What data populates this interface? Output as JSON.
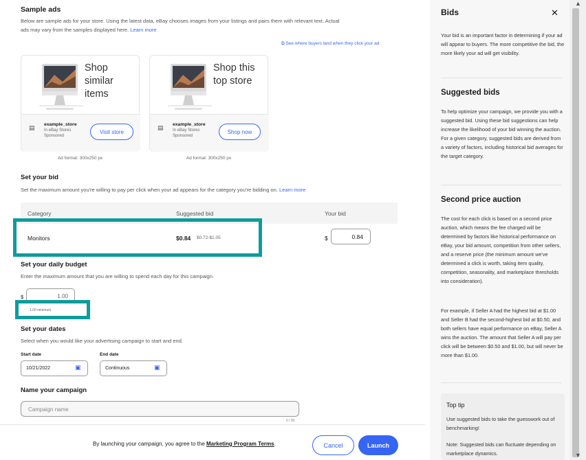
{
  "sample_ads": {
    "title": "Sample ads",
    "desc_line1": "Below are sample ads for your store. Using the latest data, eBay chooses images from your listings and pairs them with relevant text. Actual",
    "desc_line2": "ads may vary from the samples displayed here.",
    "learn_more": "Learn more",
    "buyers_link": "See where buyers land when they click your ad",
    "cards": [
      {
        "headline": "Shop\nsimilar\nitems",
        "store": "example_store",
        "sub1": "In eBay Stores",
        "sub2": "Sponsored",
        "button": "Visit store",
        "format": "Ad format: 300x250 px"
      },
      {
        "headline": "Shop this\ntop store",
        "store": "example_store",
        "sub1": "In eBay Stores",
        "sub2": "Sponsored",
        "button": "Shop now",
        "format": "Ad format: 300x250 px"
      }
    ]
  },
  "bid": {
    "title": "Set your bid",
    "desc": "Set the maximum amount you're willing to pay per click when your ad appears for the category you're bidding on.",
    "learn_more": "Learn more",
    "columns": [
      "Category",
      "Suggested bid",
      "Your bid"
    ],
    "row": {
      "category": "Monitors",
      "suggested": "$0.84",
      "range": "$0.72-$1.05",
      "currency": "$",
      "your_bid": "0.84"
    }
  },
  "budget": {
    "title": "Set your daily budget",
    "desc": "Enter the maximum amount that you are willing to spend each day for this campaign.",
    "currency": "$",
    "value": "1.00",
    "hint": "1.00 minimum"
  },
  "dates": {
    "title": "Set your dates",
    "desc": "Select when you would like your advertising campaign to start and end.",
    "start_label": "Start date",
    "start_value": "10/21/2022",
    "end_label": "End date",
    "end_value": "Continuous"
  },
  "campaign": {
    "title": "Name your campaign",
    "placeholder": "Campaign name",
    "counter": "0 / 80"
  },
  "footer": {
    "text": "By launching your campaign, you agree to the",
    "terms": "Marketing Program Terms",
    "period": ".",
    "cancel": "Cancel",
    "launch": "Launch"
  },
  "side": {
    "title": "Bids",
    "intro": "Your bid is an important factor in determining if your ad will appear to buyers. The more competitive the bid, the more likely your ad will get visibility.",
    "suggested_title": "Suggested bids",
    "suggested_text": "To help optimize your campaign, we provide you with a suggested bid. Using these bid suggestions can help increase the likelihood of your bid winning the auction. For a given category, suggested bids are derived from a variety of factors, including historical bid averages for the target category.",
    "auction_title": "Second price auction",
    "auction_text": "The cost for each click is based on a second price auction, which means the fee charged will be determined by factors like historical performance on eBay, your bid amount, competition from other sellers, and a reserve price (the minimum amount we've determined a click is worth, taking item quality, competition, seasonality, and marketplace thresholds into consideration).",
    "example_text": "For example, if Seller A had the highest bid at $1.00 and Seller B had the second-highest bid at $0.50, and both sellers have equal performance on eBay, Seller A wins the auction. The amount that Seller A will pay per click will be between $0.50 and $1.00, but will never be more than $1.00.",
    "tip_title": "Top tip",
    "tip_text1": "Use suggested bids to take the guesswork out of benchmarking!",
    "tip_text2": "Note: Suggested bids can fluctuate depending on marketplace dynamics."
  },
  "colors": {
    "accent": "#3665f3",
    "highlight": "#0e9c9c"
  }
}
